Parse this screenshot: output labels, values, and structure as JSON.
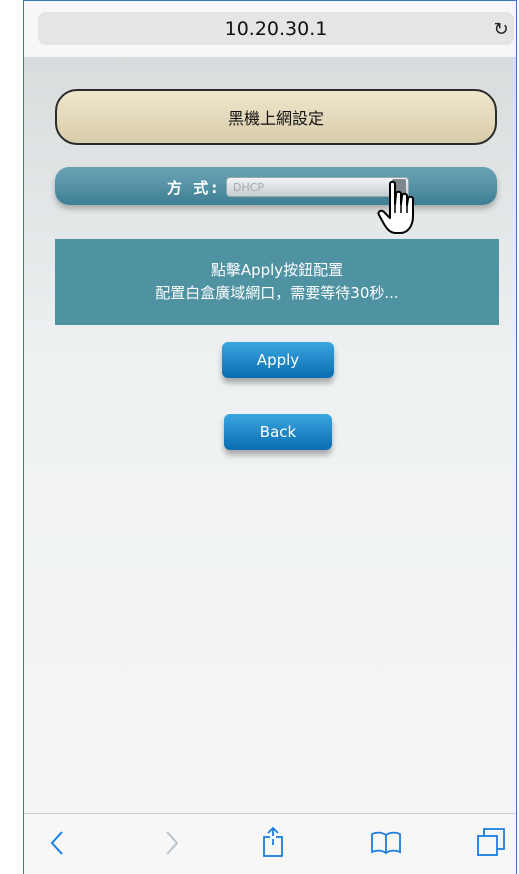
{
  "browser": {
    "url": "10.20.30.1",
    "reload_icon": "reload-icon"
  },
  "page": {
    "title": "黑機上網設定",
    "mode_label": "方 式:",
    "mode_value": "DHCP",
    "info_line1": "點擊Apply按鈕配置",
    "info_line2": "配置白盒廣域網口，需要等待30秒...",
    "apply_label": "Apply",
    "back_label": "Back"
  },
  "toolbar": {
    "icons": [
      "back-arrow-icon",
      "forward-arrow-icon",
      "share-icon",
      "bookmarks-icon",
      "tabs-icon"
    ]
  },
  "colors": {
    "accent_blue": "#1a86c9",
    "panel_teal": "#4f93a3",
    "title_panel": "#e4d9bb"
  }
}
